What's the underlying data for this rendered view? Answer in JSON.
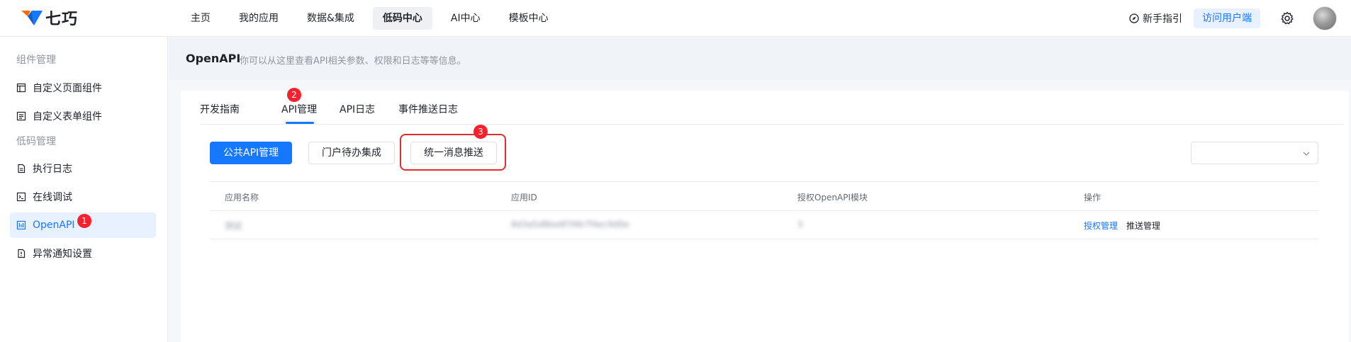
{
  "header": {
    "logo_text": "七巧",
    "nav": [
      "主页",
      "我的应用",
      "数据&集成",
      "低码中心",
      "AI中心",
      "模板中心"
    ],
    "active_nav": "低码中心",
    "guide_label": "新手指引",
    "visit_label": "访问用户端",
    "brand_color": "#1677ff"
  },
  "sidebar": {
    "group1": "组件管理",
    "group2": "低码管理",
    "items": [
      {
        "label": "自定义页面组件",
        "icon": "layout-icon"
      },
      {
        "label": "自定义表单组件",
        "icon": "form-icon"
      },
      {
        "label": "执行日志",
        "icon": "document-icon"
      },
      {
        "label": "在线调试",
        "icon": "terminal-icon"
      },
      {
        "label": "OpenAPI",
        "icon": "api-icon"
      },
      {
        "label": "异常通知设置",
        "icon": "alert-icon"
      }
    ],
    "active_item": "OpenAPI"
  },
  "page": {
    "title": "OpenAPI",
    "description": "你可以从这里查看API相关参数、权限和日志等等信息。"
  },
  "tabs": [
    "开发指南",
    "API管理",
    "API日志",
    "事件推送日志"
  ],
  "active_tab": "API管理",
  "buttons": {
    "public_api": "公共API管理",
    "portal_todo": "门户待办集成",
    "unified_push": "统一消息推送"
  },
  "table": {
    "columns": [
      "应用名称",
      "应用ID",
      "授权OpenAPI模块",
      "操作"
    ],
    "rows": [
      {
        "name": "测试",
        "app_id": "8d3a5d8be6f39b7f4ec9d0e",
        "modules": "3",
        "actions": [
          "授权管理",
          "推送管理"
        ]
      }
    ]
  },
  "annotations": {
    "badge1": "1",
    "badge2": "2",
    "badge3": "3"
  }
}
